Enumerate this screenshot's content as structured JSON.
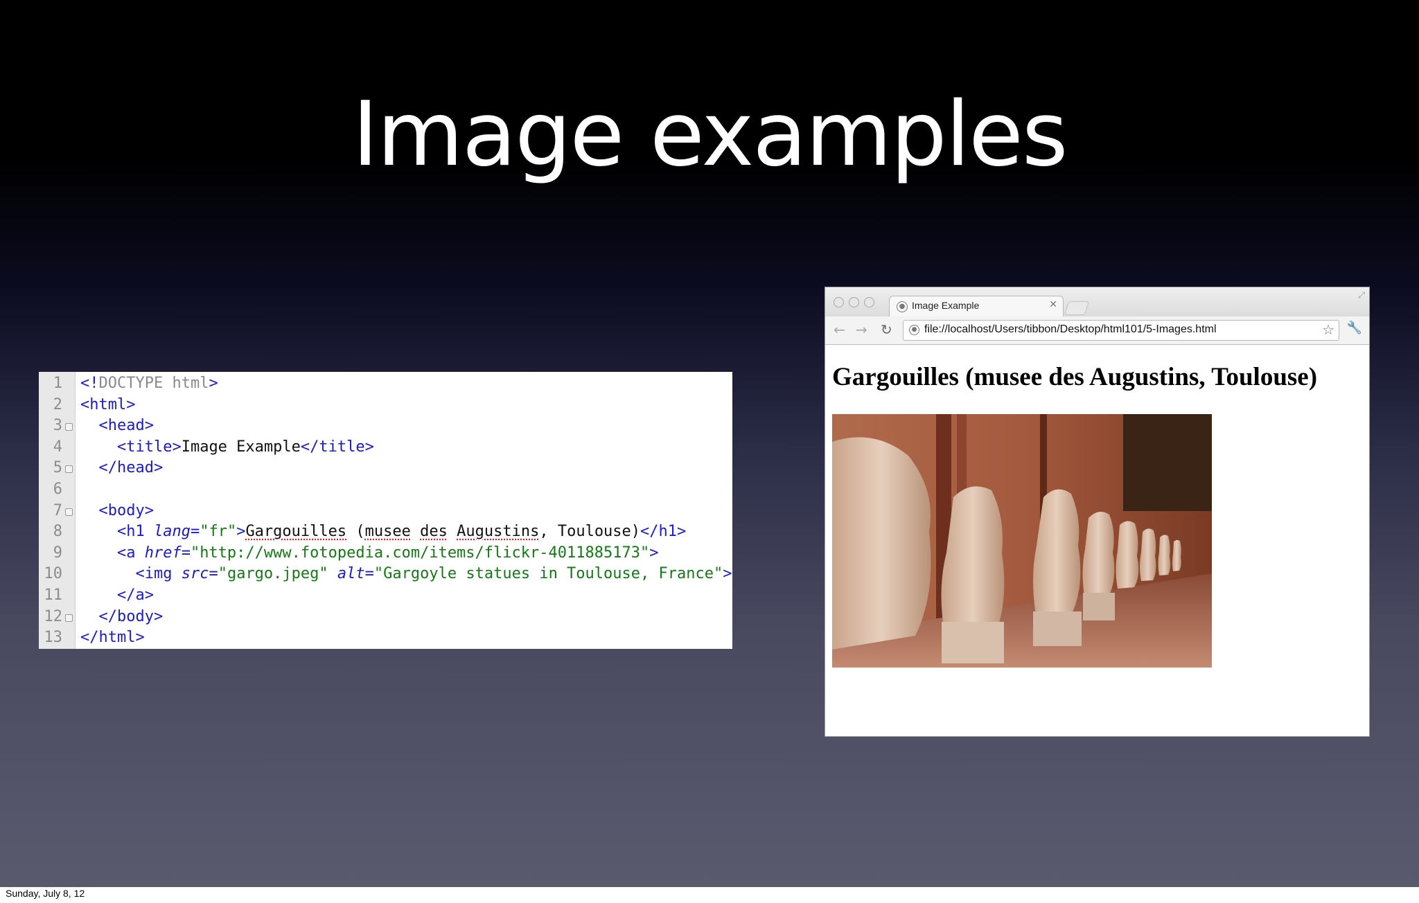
{
  "slide": {
    "title": "Image examples",
    "footer_date": "Sunday, July 8, 12"
  },
  "editor": {
    "line_numbers": [
      "1",
      "2",
      "3",
      "4",
      "5",
      "6",
      "7",
      "8",
      "9",
      "10",
      "11",
      "12",
      "13"
    ],
    "fold_markers_on_lines": [
      3,
      5,
      7,
      12
    ],
    "lines": [
      {
        "segments": [
          {
            "t": "<!",
            "c": "tag"
          },
          {
            "t": "DOCTYPE html",
            "c": "doc"
          },
          {
            "t": ">",
            "c": "tag"
          }
        ]
      },
      {
        "segments": [
          {
            "t": "<html>",
            "c": "tag"
          }
        ]
      },
      {
        "segments": [
          {
            "t": "  <head>",
            "c": "tag"
          }
        ]
      },
      {
        "segments": [
          {
            "t": "    <title>",
            "c": "tag"
          },
          {
            "t": "Image Example",
            "c": "plain"
          },
          {
            "t": "</title>",
            "c": "tag"
          }
        ]
      },
      {
        "segments": [
          {
            "t": "  </head>",
            "c": "tag"
          }
        ]
      },
      {
        "segments": []
      },
      {
        "segments": [
          {
            "t": "  <body>",
            "c": "tag"
          }
        ]
      },
      {
        "segments": [
          {
            "t": "    <h1 ",
            "c": "tag"
          },
          {
            "t": "lang",
            "c": "attr"
          },
          {
            "t": "=",
            "c": "tag"
          },
          {
            "t": "\"fr\"",
            "c": "str"
          },
          {
            "t": ">",
            "c": "tag"
          },
          {
            "t": "Gargouilles",
            "c": "plain spell"
          },
          {
            "t": " (",
            "c": "plain"
          },
          {
            "t": "musee",
            "c": "plain spell"
          },
          {
            "t": " ",
            "c": "plain"
          },
          {
            "t": "des",
            "c": "plain spell"
          },
          {
            "t": " ",
            "c": "plain"
          },
          {
            "t": "Augustins",
            "c": "plain spell"
          },
          {
            "t": ", Toulouse)",
            "c": "plain"
          },
          {
            "t": "</h1>",
            "c": "tag"
          }
        ]
      },
      {
        "segments": [
          {
            "t": "    <a ",
            "c": "tag"
          },
          {
            "t": "href",
            "c": "attr"
          },
          {
            "t": "=",
            "c": "tag"
          },
          {
            "t": "\"http://www.fotopedia.com/items/flickr-4011885173\"",
            "c": "str"
          },
          {
            "t": ">",
            "c": "tag"
          }
        ]
      },
      {
        "segments": [
          {
            "t": "      <img ",
            "c": "tag"
          },
          {
            "t": "src",
            "c": "attr"
          },
          {
            "t": "=",
            "c": "tag"
          },
          {
            "t": "\"gargo.jpeg\"",
            "c": "str"
          },
          {
            "t": " ",
            "c": "tag"
          },
          {
            "t": "alt",
            "c": "attr"
          },
          {
            "t": "=",
            "c": "tag"
          },
          {
            "t": "\"Gargoyle statues in Toulouse, France\"",
            "c": "str"
          },
          {
            "t": ">",
            "c": "tag"
          }
        ]
      },
      {
        "segments": [
          {
            "t": "    </a>",
            "c": "tag"
          }
        ]
      },
      {
        "segments": [
          {
            "t": "  </body>",
            "c": "tag"
          }
        ]
      },
      {
        "segments": [
          {
            "t": "</html>",
            "c": "tag"
          }
        ]
      }
    ]
  },
  "browser": {
    "tab_title": "Image Example",
    "url": "file://localhost/Users/tibbon/Desktop/html101/5-Images.html",
    "page_heading": "Gargouilles (musee des Augustins, Toulouse)",
    "image_alt": "Gargoyle statues in Toulouse, France"
  },
  "colors": {
    "tag": "#1a1ad0",
    "string": "#137b13",
    "doctype": "#8a8a8a"
  }
}
